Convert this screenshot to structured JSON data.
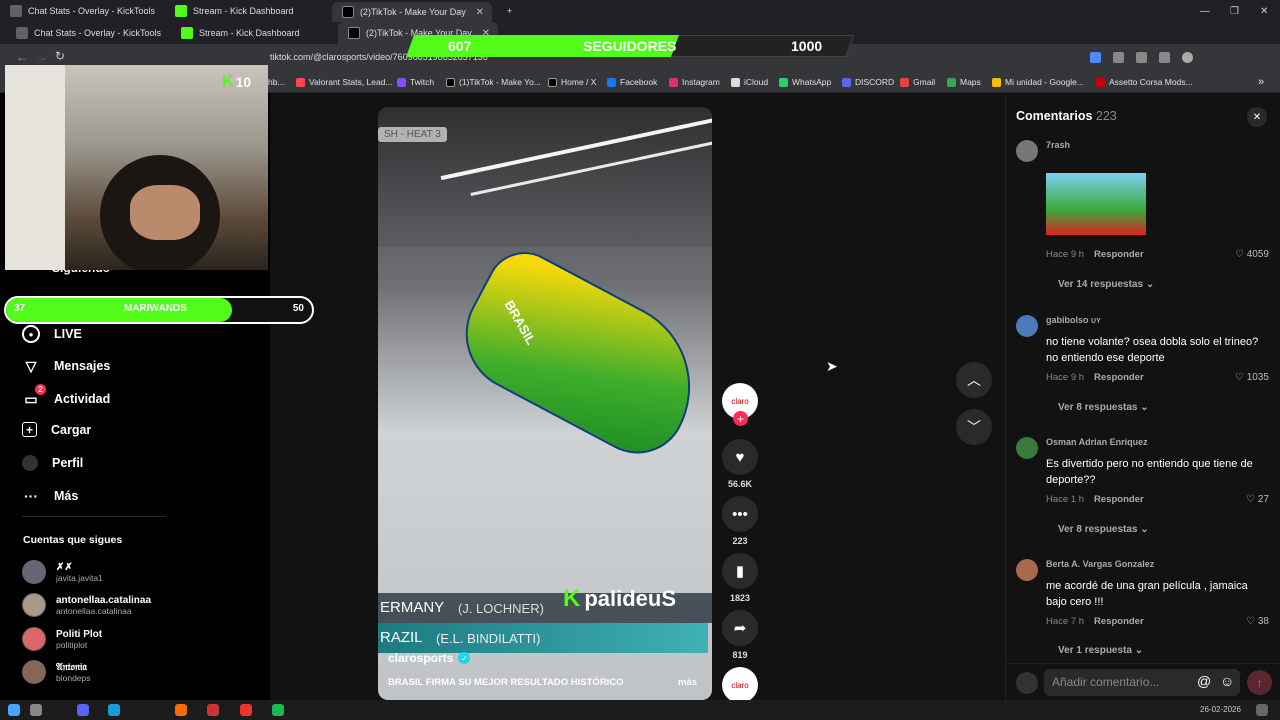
{
  "tabs": [
    {
      "label": "Chat Stats - Overlay - KickTools",
      "color": "#9aa0a6"
    },
    {
      "label": "Stream - Kick Dashboard",
      "color": "#53fc18"
    },
    {
      "label": "(2)TikTok - Make Your Day",
      "color": "#ffffff"
    }
  ],
  "tabs_dup": [
    {
      "label": "Chat Stats - Overlay - KickTools"
    },
    {
      "label": "Stream - Kick Dashboard"
    },
    {
      "label": "(2)TikTok - Make Your Day"
    }
  ],
  "address": {
    "url": "tiktok.com/@clarosports/video/7609685198652837136"
  },
  "overlay": {
    "current": "607",
    "label": "SEGUIDORES",
    "goal": "1000",
    "kick_badge": "10"
  },
  "bookmarks": [
    "hb...",
    "Valorant Stats, Lead...",
    "Twitch",
    "(1)TikTok - Make Yo...",
    "Home / X",
    "Facebook",
    "Instagram",
    "iCloud",
    "WhatsApp",
    "DISCORD",
    "Gmail",
    "Maps",
    "Mi unidad - Google...",
    "Assetto Corsa Mods..."
  ],
  "sidebar": {
    "following_label": "Siguiendo",
    "goal": {
      "left": "37",
      "name": "MARIWANDS",
      "right": "50",
      "fill": 0.74
    },
    "nav": [
      {
        "label": "LIVE",
        "icon": "live-icon"
      },
      {
        "label": "Mensajes",
        "icon": "send-icon"
      },
      {
        "label": "Actividad",
        "icon": "inbox-icon",
        "badge": "2"
      },
      {
        "label": "Cargar",
        "icon": "upload-icon"
      },
      {
        "label": "Perfil",
        "icon": "profile-icon"
      },
      {
        "label": "Más",
        "icon": "more-icon"
      }
    ],
    "following_title": "Cuentas que sigues",
    "accounts": [
      {
        "name": "✗✗",
        "handle": "javita.javita1"
      },
      {
        "name": "antonellaa.catalinaa",
        "handle": "antonellaa.catalinaa"
      },
      {
        "name": "Politi Plot",
        "handle": "politiplot"
      },
      {
        "name": "𝔄𝔫𝔱𝔬𝔫𝔦𝔞",
        "handle": "blondeps"
      }
    ]
  },
  "video": {
    "heat_label": "SH - HEAT 3",
    "line1_country": "ERMANY",
    "line1_name": "(J. LOCHNER)",
    "line2_country": "RAZIL",
    "line2_name": "(E.L. BINDILATTI)",
    "watermark": "palideuS",
    "author": "clarosports",
    "caption": "BRASIL FIRMA SU MEJOR RESULTADO HISTÓRICO",
    "caption_more": "más",
    "sled_text": "BRASIL"
  },
  "actions": {
    "likes": "56.6K",
    "comments": "223",
    "saves": "1823",
    "shares": "819"
  },
  "comments": {
    "title": "Comentarios",
    "count": "223",
    "items": [
      {
        "user": "7rash",
        "text": "",
        "time": "Hace 9 h",
        "reply": "Responder",
        "likes": "4059",
        "more": "Ver 14 respuestas"
      },
      {
        "user": "gabibolso",
        "user_badge": "UY",
        "text": "no tiene volante? osea dobla solo el trineo? no entiendo ese deporte",
        "time": "Hace 9 h",
        "reply": "Responder",
        "likes": "1035",
        "more": "Ver 8 respuestas"
      },
      {
        "user": "Osman Adrian Enriquez",
        "text": "Es divertido pero no entiendo que tiene de deporte??",
        "time": "Hace 1 h",
        "reply": "Responder",
        "likes": "27",
        "more": "Ver 8 respuestas"
      },
      {
        "user": "Berta A. Vargas Gonzalez",
        "text": "me acordé de una gran película , jamaica bajo cero !!!",
        "time": "Hace 7 h",
        "reply": "Responder",
        "likes": "38",
        "more": "Ver 1 respuesta"
      }
    ],
    "input_placeholder": "Añadir comentario..."
  },
  "taskbar": {
    "date": "26-02-2026"
  },
  "colors": {
    "kick_green": "#53fc18",
    "tiktok_red": "#fe2c55"
  }
}
